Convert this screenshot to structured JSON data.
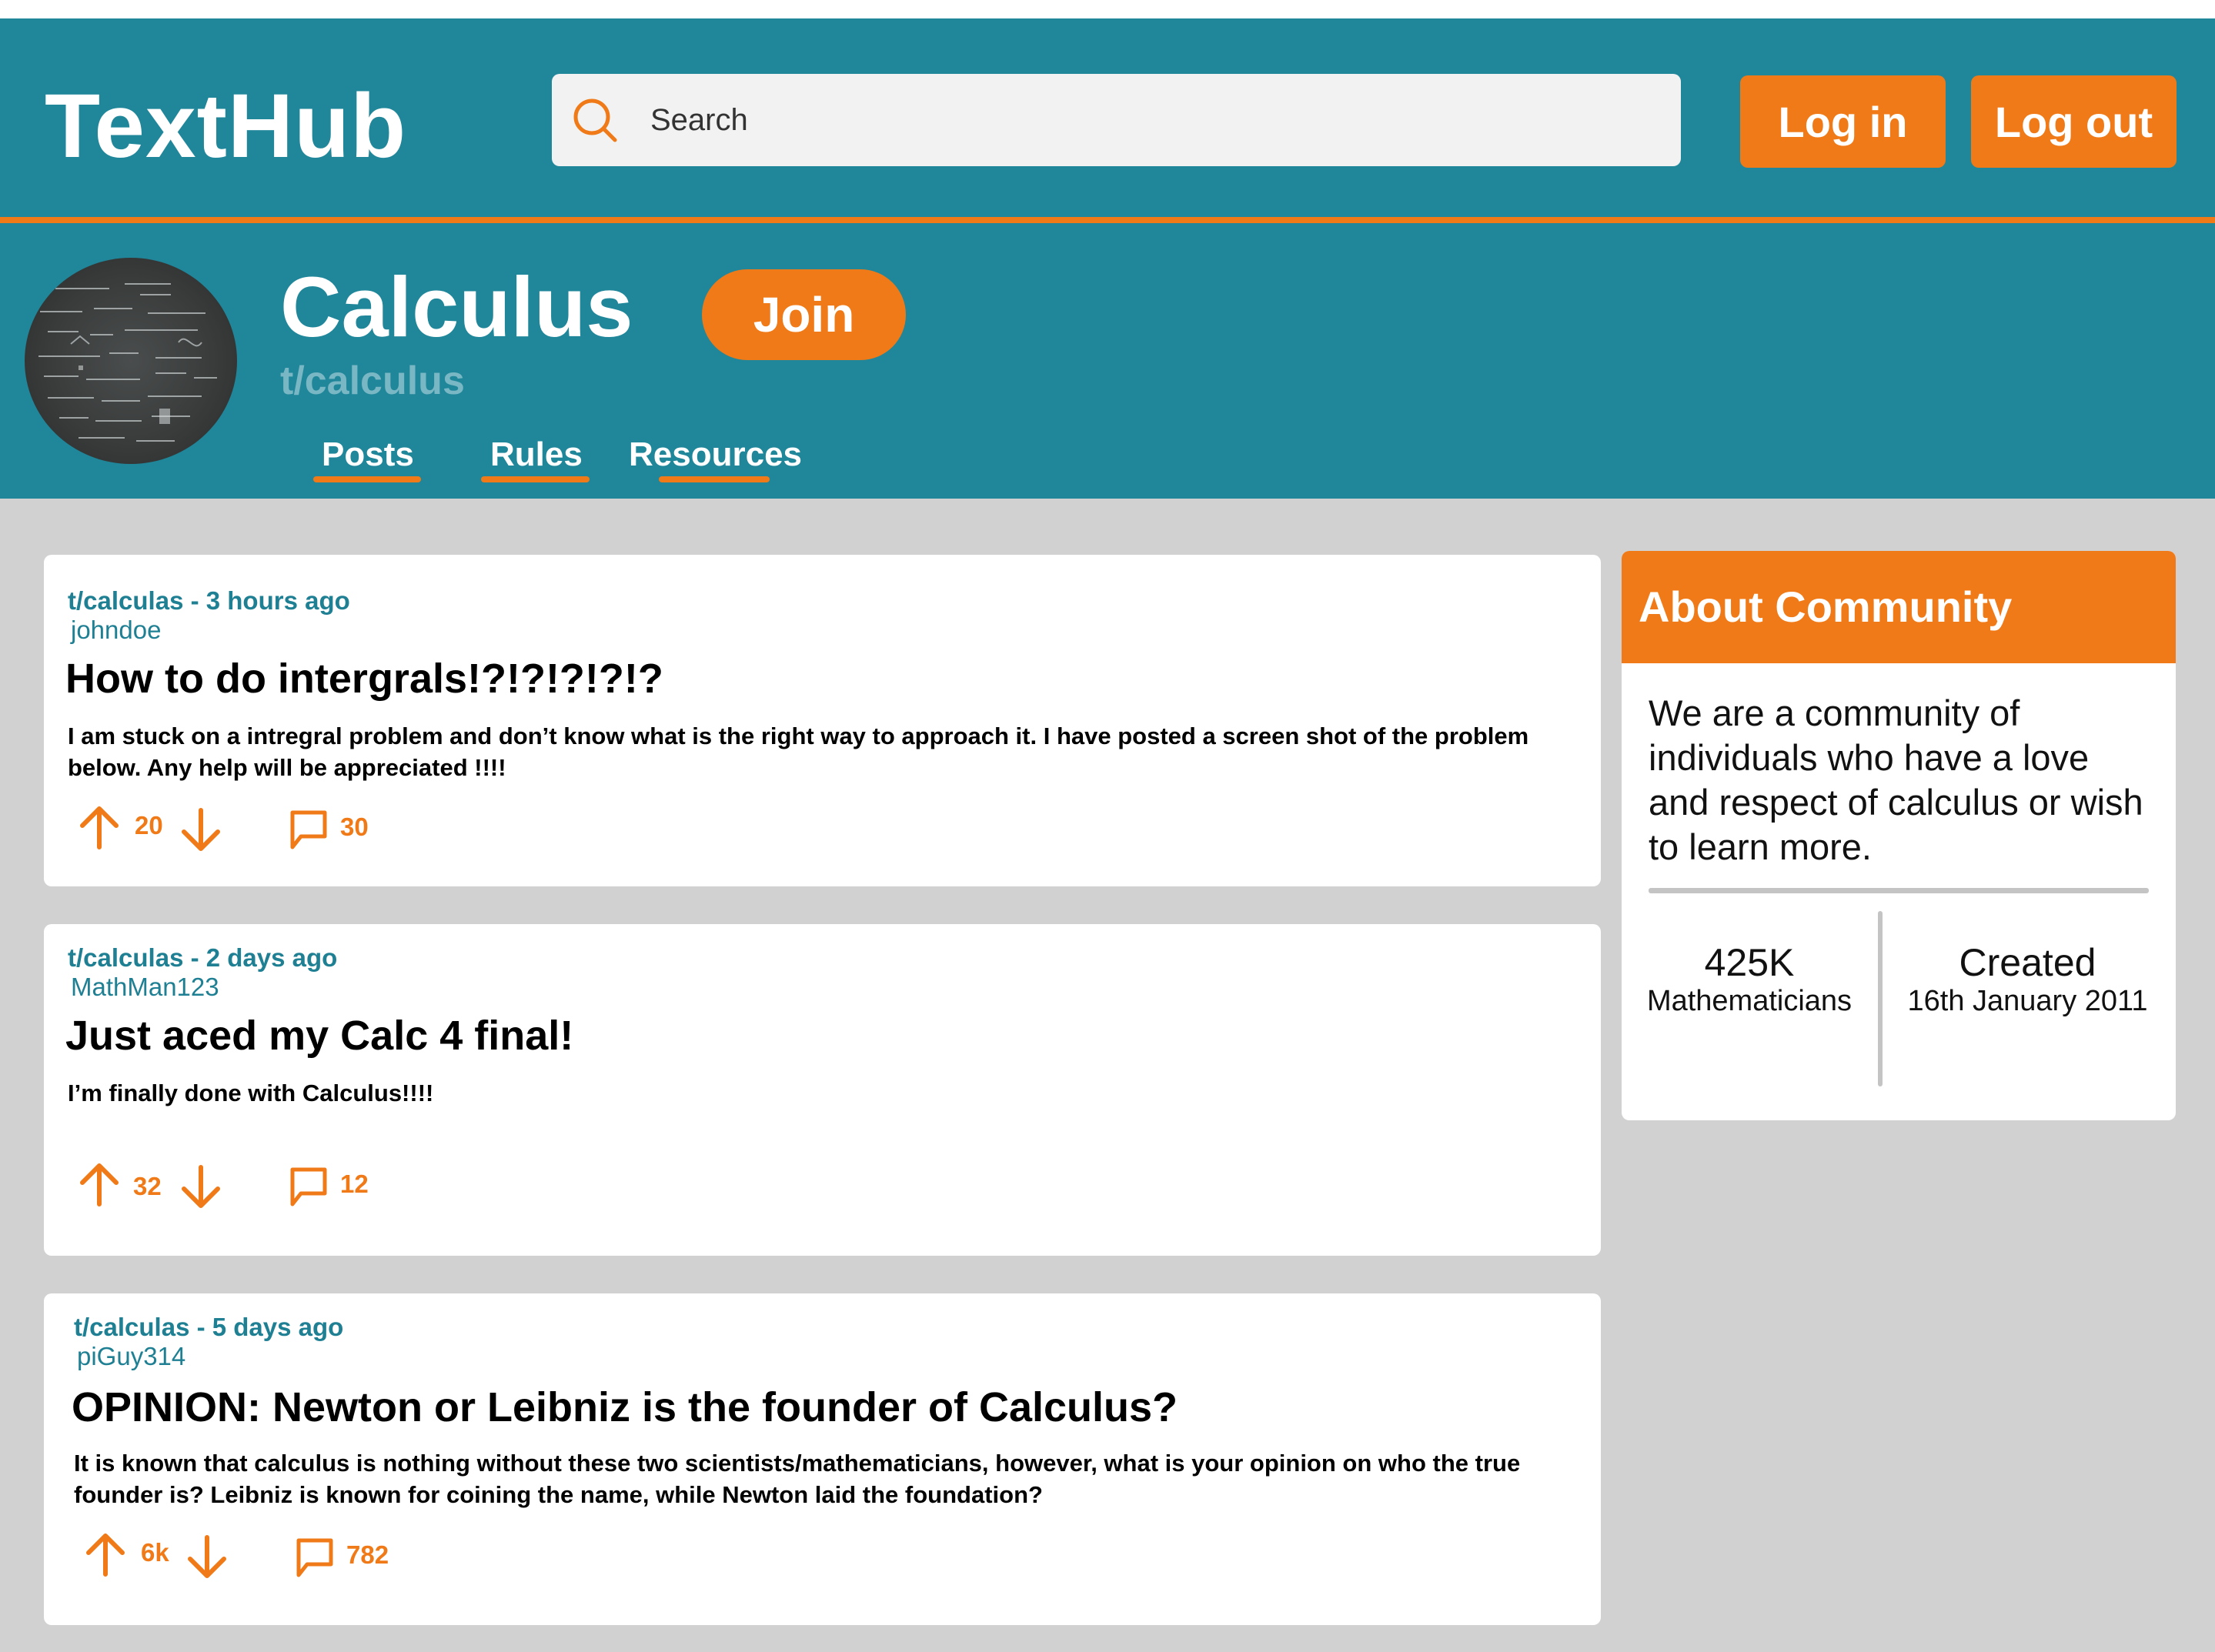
{
  "app": {
    "logo": "TextHub"
  },
  "search": {
    "placeholder": "Search"
  },
  "auth": {
    "login_label": "Log in",
    "logout_label": "Log out"
  },
  "community": {
    "title": "Calculus",
    "join_label": "Join",
    "handle": "t/calculus",
    "tabs": [
      {
        "label": "Posts"
      },
      {
        "label": "Rules"
      },
      {
        "label": "Resources"
      }
    ]
  },
  "posts": [
    {
      "meta": "t/calculas - 3 hours ago",
      "author": "johndoe",
      "title": "How to do intergrals!?!?!?!?!?",
      "body": "I am stuck on a intregral problem and don’t know what is the right way to approach it. I have posted a screen shot of the problem below. Any help will be appreciated !!!!",
      "votes": "20",
      "comments": "30"
    },
    {
      "meta": "t/calculas - 2 days ago",
      "author": "MathMan123",
      "title": "Just aced my Calc 4 final!",
      "body": "I’m finally done with Calculus!!!!",
      "votes": "32",
      "comments": "12"
    },
    {
      "meta": "t/calculas - 5 days ago",
      "author": "piGuy314",
      "title": "OPINION: Newton or Leibniz is the founder of Calculus?",
      "body": "It is known that calculus is nothing without these two scientists/mathematicians, however, what is your opinion on who the true founder is? Leibniz is known for coining the name, while Newton laid the foundation?",
      "votes": "6k",
      "comments": "782"
    }
  ],
  "about": {
    "title": "About Community",
    "description": "We are a community of individuals who have a love and respect of calculus or wish to learn more.",
    "members_count": "425K",
    "members_label": "Mathematicians",
    "created_label": "Created",
    "created_date": "16th January 2011"
  },
  "colors": {
    "header": "#20869a",
    "accent": "#ef7a17",
    "background": "#d1d1d1",
    "link": "#1f7f93",
    "handle": "#78b7c3"
  },
  "icons": [
    "search-icon",
    "upvote-icon",
    "downvote-icon",
    "comment-icon"
  ]
}
